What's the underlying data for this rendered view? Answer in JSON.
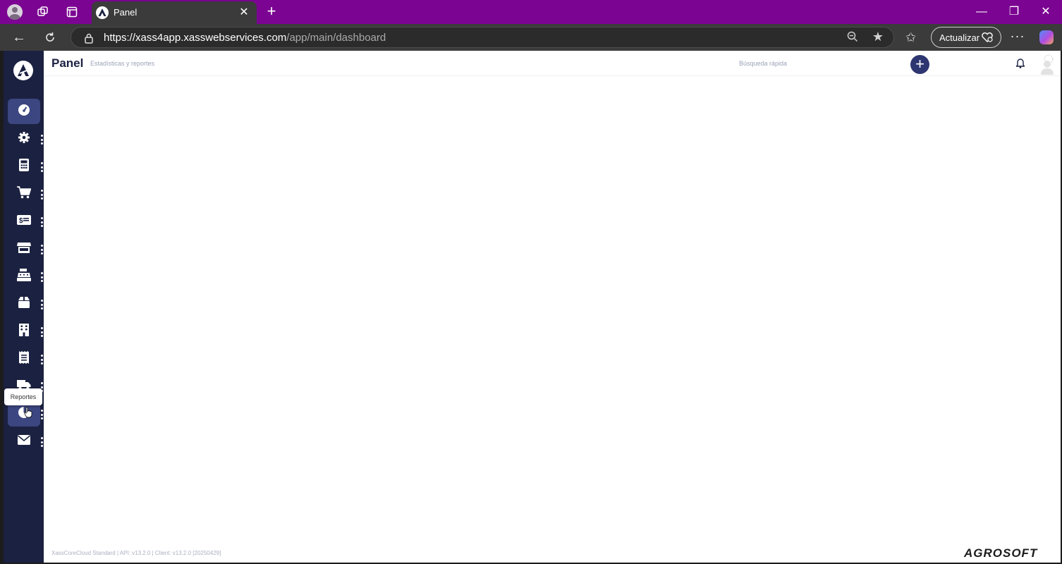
{
  "browser": {
    "tab_title": "Panel",
    "new_tab_label": "+",
    "url_host": "https://xass4app.xasswebservices.com",
    "url_path": "/app/main/dashboard",
    "update_label": "Actualizar",
    "window_minimize": "—",
    "window_restore": "❐",
    "window_close": "✕",
    "more_label": "···"
  },
  "header": {
    "title": "Panel",
    "subtitle": "Estadísticas y reportes",
    "quick_search_placeholder": "Búsqueda rápida",
    "add_label": "+"
  },
  "sidebar": {
    "items": [
      {
        "name": "dashboard",
        "icon": "gauge-icon"
      },
      {
        "name": "settings",
        "icon": "gear-icon"
      },
      {
        "name": "calculator",
        "icon": "calculator-icon"
      },
      {
        "name": "purchases",
        "icon": "cart-icon"
      },
      {
        "name": "billing",
        "icon": "money-card-icon"
      },
      {
        "name": "store",
        "icon": "store-icon"
      },
      {
        "name": "cash-register",
        "icon": "cash-register-icon"
      },
      {
        "name": "inventory",
        "icon": "box-icon"
      },
      {
        "name": "company",
        "icon": "building-icon"
      },
      {
        "name": "receipts",
        "icon": "receipt-icon"
      },
      {
        "name": "logistics",
        "icon": "truck-icon"
      },
      {
        "name": "reports",
        "icon": "pie-chart-icon"
      },
      {
        "name": "messages",
        "icon": "envelope-icon"
      }
    ],
    "tooltip": "Reportes"
  },
  "footer": {
    "version": "XassCoreCloud Standard | API: v13.2.0 | Client: v13.2.0 [20250429]",
    "brand": "AGROSOFT"
  },
  "colors": {
    "browser_frame": "#7b0492",
    "sidebar_bg": "#1b2140",
    "sidebar_active": "#3c4681",
    "accent": "#2d3670"
  }
}
